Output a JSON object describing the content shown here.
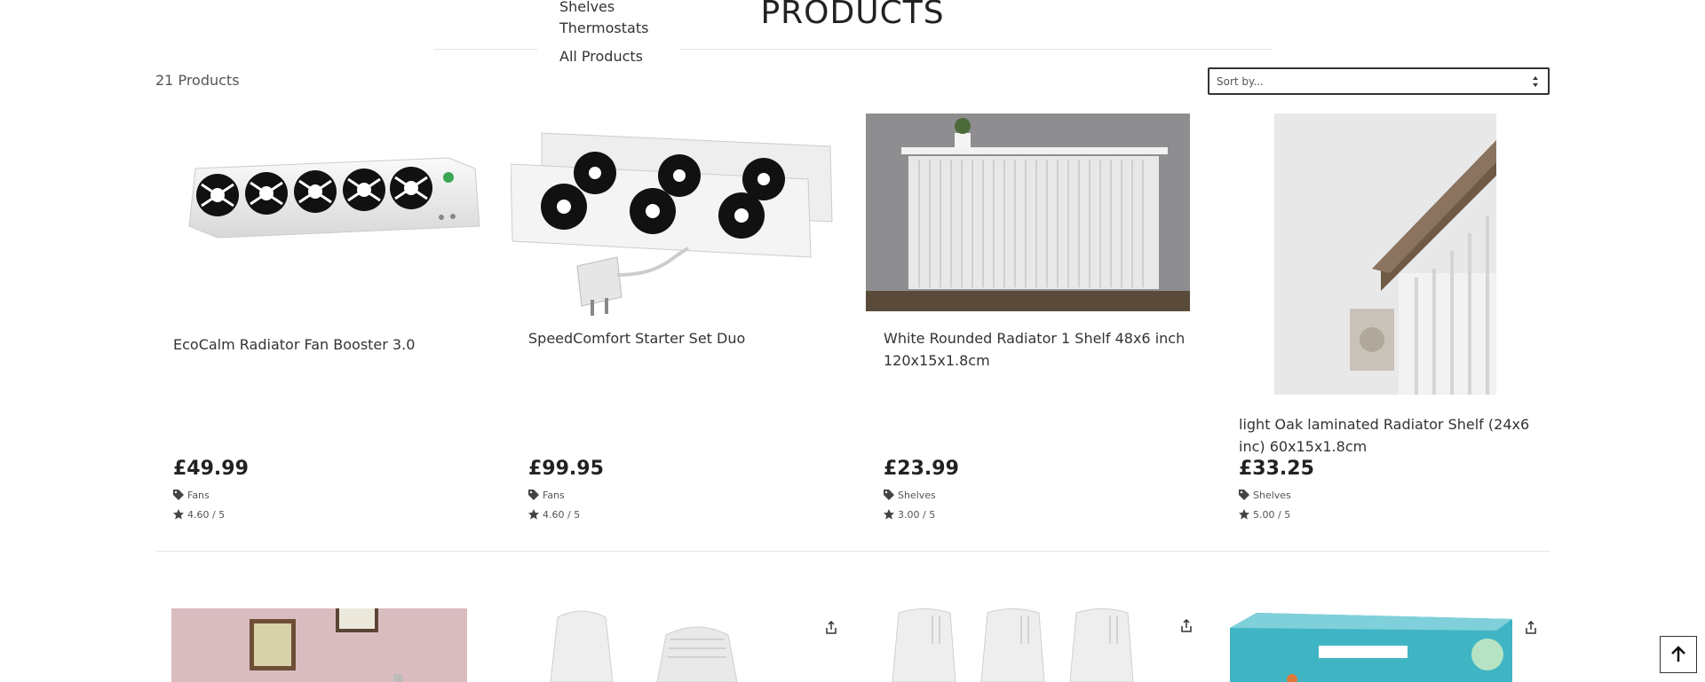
{
  "header": {
    "title": "PRODUCTS",
    "categories": [
      "Shelves",
      "Thermostats",
      "All Products"
    ]
  },
  "toolbar": {
    "count": "21 Products",
    "sort_placeholder": "Sort by..."
  },
  "products": [
    {
      "name": "EcoCalm Radiator Fan Booster 3.0",
      "price": "£49.99",
      "category": "Fans",
      "rating": "4.60 / 5",
      "image": "radiator-fan-booster-image"
    },
    {
      "name": "SpeedComfort Starter Set Duo",
      "price": "£99.95",
      "category": "Fans",
      "rating": "4.60 / 5",
      "image": "radiator-fan-duo-image"
    },
    {
      "name": "White Rounded Radiator 1 Shelf 48x6 inch 120x15x1.8cm",
      "price": "£23.99",
      "category": "Shelves",
      "rating": "3.00 / 5",
      "image": "white-radiator-shelf-image"
    },
    {
      "name": "light Oak laminated Radiator Shelf (24x6 inc) 60x15x1.8cm",
      "price": "£33.25",
      "category": "Shelves",
      "rating": "5.00 / 5",
      "image": "oak-radiator-shelf-image"
    }
  ],
  "second_row": [
    "room-photo-image",
    "thermostat-heads-image",
    "thermostat-heads-three-image",
    "kasa-thermostat-box-image"
  ],
  "colors": {
    "text": "#333333",
    "border": "#e4e4e4",
    "room_wall": "#d9bcc0",
    "kasa_box": "#3fb5c4"
  }
}
